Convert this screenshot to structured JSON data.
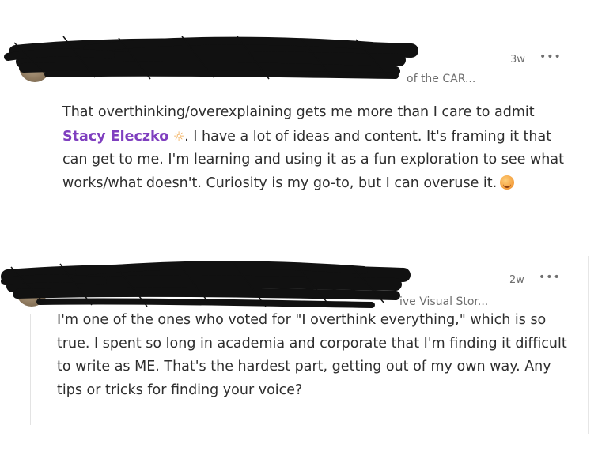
{
  "comments": [
    {
      "time": "3w",
      "more": "•••",
      "meta_tail": "of the CAR...",
      "text_before_mention": "That overthinking/overexplaining gets me more than I care to admit ",
      "mention": "Stacy Eleczko",
      "mention_icon": "☼",
      "text_after_mention": ". I have a lot of ideas and content. It's framing it that can get to me. I'm learning and using it as a fun exploration to see what works/what doesn't. Curiosity is my go-to, but I can overuse it.",
      "emoji": "smiling-face-emoji"
    },
    {
      "time": "2w",
      "more": "•••",
      "meta_tail": "ive Visual Stor...",
      "text": "I'm one of the ones who voted for \"I overthink everything,\" which is so true. I spent so long in academia and corporate that I'm finding it difficult to write as ME. That's the hardest part, getting out of my own way. Any tips or tricks for finding your voice?"
    }
  ],
  "colors": {
    "mention": "#7f3fbf",
    "redaction": "#111111",
    "meta": "#6f6f6f"
  }
}
